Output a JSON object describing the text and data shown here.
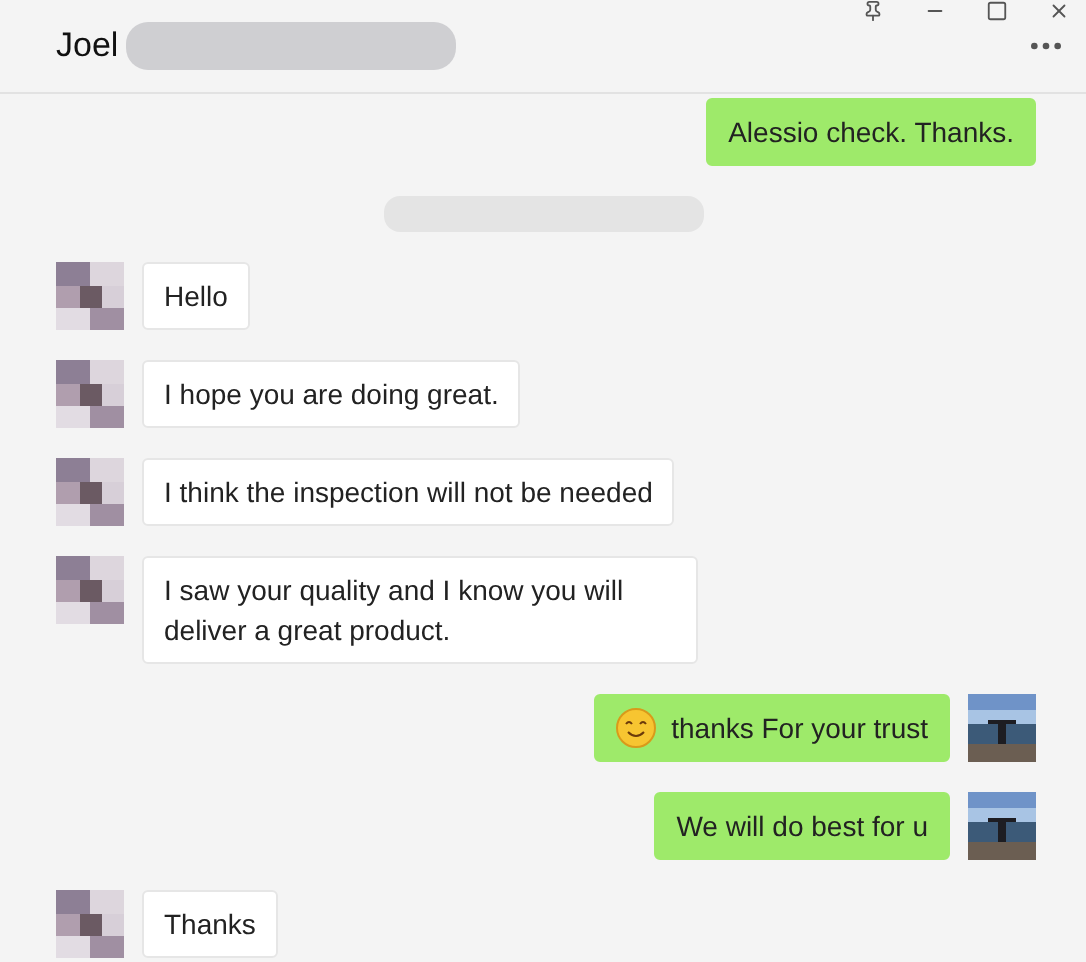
{
  "window": {
    "title": "Joel"
  },
  "messages": [
    {
      "kind": "sent",
      "text": "Alessio check. Thanks.",
      "emoji": false
    },
    {
      "kind": "redacted"
    },
    {
      "kind": "received",
      "text": "Hello",
      "emoji": false
    },
    {
      "kind": "received",
      "text": "I hope you are doing great.",
      "emoji": false
    },
    {
      "kind": "received",
      "text": "I think the inspection will not be needed",
      "emoji": false
    },
    {
      "kind": "received",
      "text": "I saw your quality and I know you will deliver a great product.",
      "emoji": false
    },
    {
      "kind": "sent",
      "text": "thanks For your trust",
      "emoji": true
    },
    {
      "kind": "sent",
      "text": "We will do best for u",
      "emoji": false
    },
    {
      "kind": "received",
      "text": "Thanks",
      "emoji": false
    }
  ]
}
